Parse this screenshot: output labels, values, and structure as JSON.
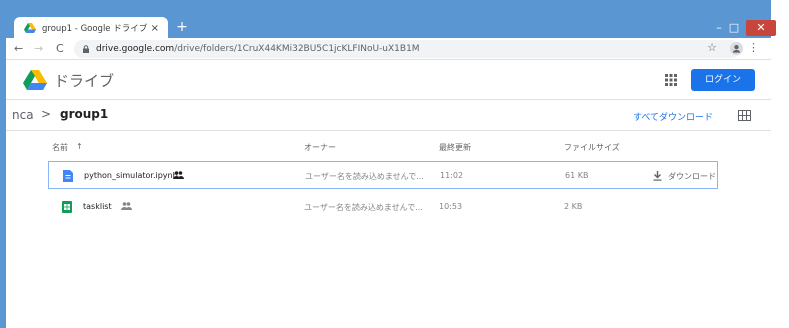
{
  "browser": {
    "tab_title": "group1 - Google ドライブ",
    "tab_close": "×",
    "new_tab": "+",
    "url_host": "drive.google.com",
    "url_path": "/drive/folders/1CruX44KMi32BU5C1jcKLFINoU-uX1B1M",
    "window_min": "–",
    "window_max": "□",
    "window_close": "✕",
    "back": "←",
    "forward": "→",
    "reload": "C",
    "star": "☆",
    "menu": "⋮"
  },
  "drive": {
    "brand": "ドライブ",
    "login_label": "ログイン",
    "breadcrumb_parent": "nca",
    "breadcrumb_separator": ">",
    "breadcrumb_current": "group1",
    "download_all": "すべてダウンロード",
    "columns": {
      "name": "名前",
      "sort_arrow": "↑",
      "owner": "オーナー",
      "modified": "最終更新",
      "size": "ファイルサイズ"
    },
    "files": [
      {
        "name": "python_simulator.ipynb",
        "owner": "ユーザー名を読み込めませんで...",
        "modified": "11:02",
        "size": "61 KB",
        "download_label": "ダウンロード",
        "icon": "notebook-file-icon",
        "shared": true
      },
      {
        "name": "tasklist",
        "owner": "ユーザー名を読み込めませんで...",
        "modified": "10:53",
        "size": "2 KB",
        "icon": "sheets-file-icon",
        "shared": true
      }
    ]
  },
  "colors": {
    "window_frame": "#5a96d2",
    "accent_blue": "#1a73e8",
    "selection_border": "#8ab4f8",
    "sheets_green": "#0f9d58"
  }
}
